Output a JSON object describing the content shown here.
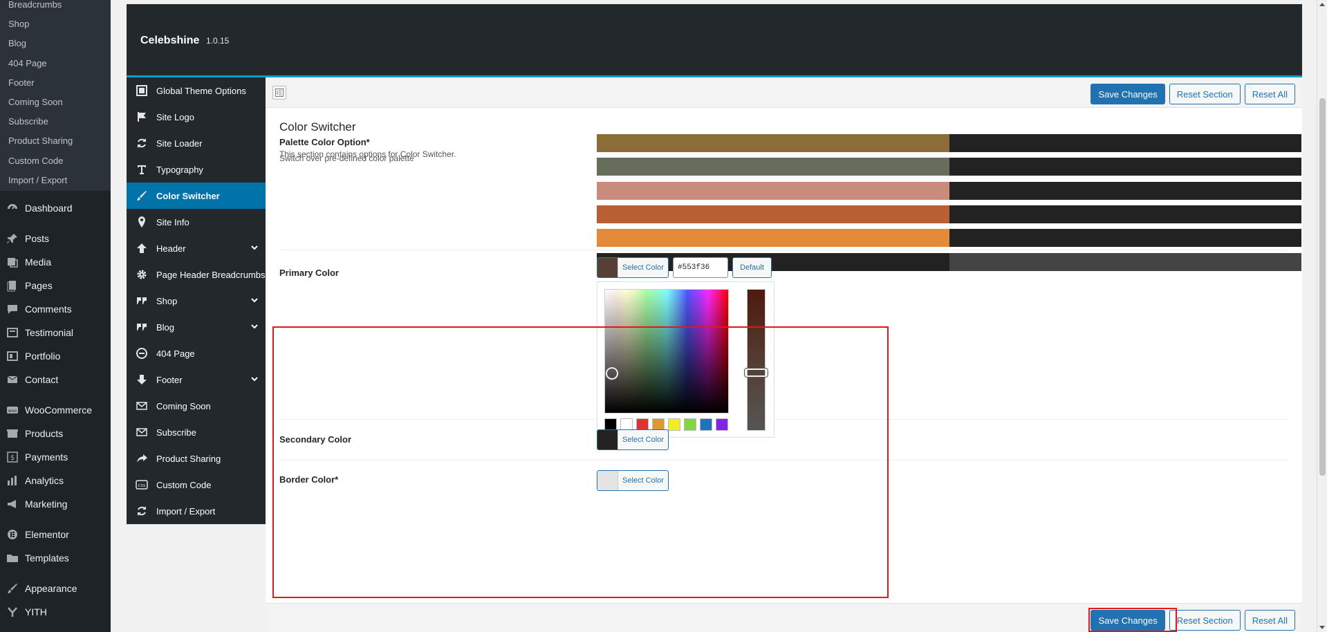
{
  "wp_menu": {
    "submenu": [
      "Breadcrumbs",
      "Shop",
      "Blog",
      "404 Page",
      "Footer",
      "Coming Soon",
      "Subscribe",
      "Product Sharing",
      "Custom Code",
      "Import / Export"
    ],
    "items": [
      {
        "label": "Dashboard",
        "icon": "dashboard-icon"
      },
      {
        "label": "Posts",
        "icon": "pin-icon"
      },
      {
        "label": "Media",
        "icon": "media-icon"
      },
      {
        "label": "Pages",
        "icon": "pages-icon"
      },
      {
        "label": "Comments",
        "icon": "comment-icon"
      },
      {
        "label": "Testimonial",
        "icon": "testimonial-icon"
      },
      {
        "label": "Portfolio",
        "icon": "portfolio-icon"
      },
      {
        "label": "Contact",
        "icon": "mail-icon"
      },
      {
        "label": "WooCommerce",
        "icon": "woo-icon"
      },
      {
        "label": "Products",
        "icon": "box-icon"
      },
      {
        "label": "Payments",
        "icon": "dollar-icon"
      },
      {
        "label": "Analytics",
        "icon": "bar-chart-icon"
      },
      {
        "label": "Marketing",
        "icon": "megaphone-icon"
      },
      {
        "label": "Elementor",
        "icon": "elementor-icon"
      },
      {
        "label": "Templates",
        "icon": "folder-icon"
      },
      {
        "label": "Appearance",
        "icon": "brush-icon"
      },
      {
        "label": "YITH",
        "icon": "yith-icon"
      }
    ]
  },
  "header": {
    "title": "Celebshine",
    "version": "1.0.15"
  },
  "nav": [
    {
      "label": "Global Theme Options",
      "icon": "panel-icon",
      "chevron": false
    },
    {
      "label": "Site Logo",
      "icon": "flag-icon",
      "chevron": false
    },
    {
      "label": "Site Loader",
      "icon": "refresh-icon",
      "chevron": false
    },
    {
      "label": "Typography",
      "icon": "text-icon",
      "chevron": false
    },
    {
      "label": "Color Switcher",
      "icon": "brush-icon",
      "chevron": false,
      "active": true
    },
    {
      "label": "Site Info",
      "icon": "location-icon",
      "chevron": false
    },
    {
      "label": "Header",
      "icon": "arrow-up-icon",
      "chevron": true
    },
    {
      "label": "Page Header Breadcrumbs",
      "icon": "gear-icon",
      "chevron": false
    },
    {
      "label": "Shop",
      "icon": "quote-icon",
      "chevron": true
    },
    {
      "label": "Blog",
      "icon": "quote-icon",
      "chevron": true
    },
    {
      "label": "404 Page",
      "icon": "minus-circle-icon",
      "chevron": false
    },
    {
      "label": "Footer",
      "icon": "arrow-down-icon",
      "chevron": true
    },
    {
      "label": "Coming Soon",
      "icon": "envelope-icon",
      "chevron": false
    },
    {
      "label": "Subscribe",
      "icon": "envelope-icon",
      "chevron": false
    },
    {
      "label": "Product Sharing",
      "icon": "share-icon",
      "chevron": false
    },
    {
      "label": "Custom Code",
      "icon": "css-icon",
      "chevron": false
    },
    {
      "label": "Import / Export",
      "icon": "refresh-icon",
      "chevron": false
    }
  ],
  "buttons": {
    "save": "Save Changes",
    "reset_section": "Reset Section",
    "reset_all": "Reset All"
  },
  "section": {
    "title": "Color Switcher",
    "description": "This section contains options for Color Switcher."
  },
  "palette_field": {
    "label": "Palette Color Option*",
    "subtitle": "Switch over pre-defined color palette",
    "palettes": [
      [
        "#8b6d3a",
        "#222222"
      ],
      [
        "#666e5b",
        "#222222"
      ],
      [
        "#c98b7b",
        "#222222"
      ],
      [
        "#b95f33",
        "#222222"
      ],
      [
        "#e58a38",
        "#222222"
      ],
      [
        "#222222",
        "#444444"
      ]
    ]
  },
  "primary_color": {
    "label": "Primary Color",
    "button_label": "Select Color",
    "value": "#553f36",
    "default_label": "Default",
    "picker_palette": [
      "#000000",
      "#ffffff",
      "#dd3333",
      "#dd9933",
      "#eeee22",
      "#81d742",
      "#1e73be",
      "#8224e3"
    ]
  },
  "secondary_color": {
    "label": "Secondary Color",
    "button_label": "Select Color",
    "value": "#222222"
  },
  "border_color": {
    "label": "Border Color*",
    "button_label": "Select Color",
    "value": "#e5e5e5"
  }
}
